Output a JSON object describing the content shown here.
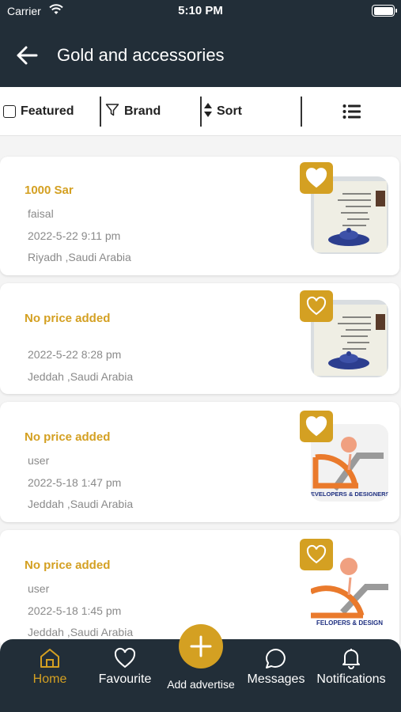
{
  "status_bar": {
    "carrier": "Carrier",
    "time": "5:10 PM"
  },
  "header": {
    "title": "Gold and accessories"
  },
  "filters": {
    "featured": "Featured",
    "brand": "Brand",
    "sort": "Sort"
  },
  "listings": [
    {
      "price": "1000 Sar",
      "user": "faisal",
      "date": "2022-5-22 9:11 pm",
      "location": "Riyadh ,Saudi Arabia",
      "favourite": true,
      "image": "document-screenshot"
    },
    {
      "price": "No price added",
      "user": "",
      "date": "2022-5-22 8:28 pm",
      "location": "Jeddah ,Saudi Arabia",
      "favourite": false,
      "image": "document-screenshot"
    },
    {
      "price": "No price added",
      "user": "user",
      "date": "2022-5-18 1:47 pm",
      "location": "Jeddah ,Saudi Arabia",
      "favourite": true,
      "image": "developers-designers-logo"
    },
    {
      "price": "No price added",
      "user": "user",
      "date": "2022-5-18 1:45 pm",
      "location": "Jeddah ,Saudi Arabia",
      "favourite": false,
      "image": "developers-designers-logo"
    }
  ],
  "logo_text": {
    "full": "DEVELOPERS & DESIGNERS",
    "cropped": "FELOPERS & DESIGN"
  },
  "bottom_nav": {
    "home": "Home",
    "favourite": "Favourite",
    "add": "Add advertise",
    "messages": "Messages",
    "notifications": "Notifications"
  },
  "colors": {
    "accent": "#d4a022",
    "header_bg": "#222e38",
    "text_muted": "#8a8a8a"
  }
}
